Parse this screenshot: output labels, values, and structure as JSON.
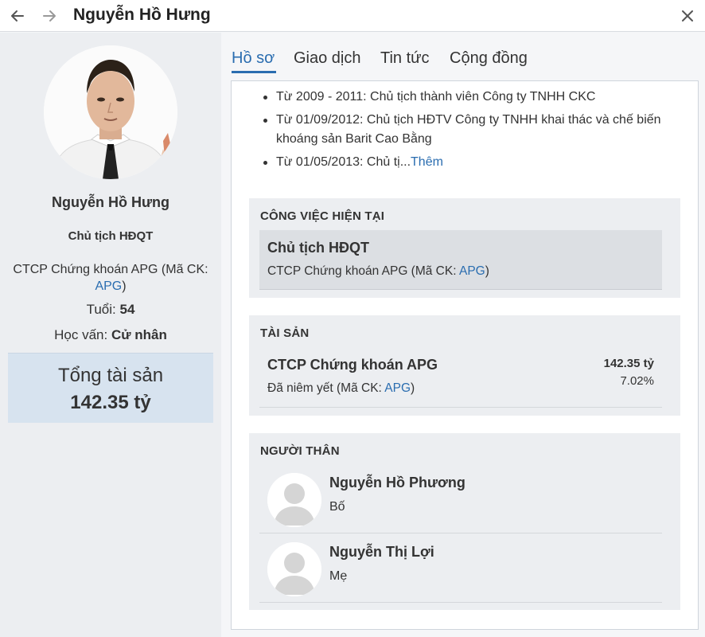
{
  "window": {
    "title": "Nguyễn Hồ Hưng",
    "back_icon": "arrow-left-icon",
    "forward_icon": "arrow-right-icon",
    "close_icon": "close-icon"
  },
  "profile": {
    "name": "Nguyễn Hồ Hưng",
    "role": "Chủ tịch HĐQT",
    "company_prefix": "CTCP Chứng khoán APG (Mã CK: ",
    "company_ticker": "APG",
    "company_suffix": ")",
    "age_label": "Tuổi: ",
    "age_value": "54",
    "education_label": "Học vấn: ",
    "education_value": "Cử nhân",
    "total_assets_label": "Tổng tài sản",
    "total_assets_value": "142.35 tỷ"
  },
  "tabs": [
    {
      "label": "Hồ sơ",
      "active": true
    },
    {
      "label": "Giao dịch",
      "active": false
    },
    {
      "label": "Tin tức",
      "active": false
    },
    {
      "label": "Cộng đồng",
      "active": false
    }
  ],
  "bio": {
    "items": [
      "Từ 2009 - 2011: Chủ tịch thành viên Công ty TNHH CKC",
      "Từ 01/09/2012: Chủ tịch HĐTV Công ty TNHH khai thác và chế biến khoáng sản Barit Cao Bằng",
      "Từ 01/05/2013: Chủ tị..."
    ],
    "more_link": "Thêm"
  },
  "current_job": {
    "section_title": "CÔNG VIỆC HIỆN TẠI",
    "title": "Chủ tịch HĐQT",
    "company_prefix": "CTCP Chứng khoán APG (Mã CK: ",
    "ticker": "APG",
    "company_suffix": ")"
  },
  "assets": {
    "section_title": "TÀI SẢN",
    "items": [
      {
        "name": "CTCP Chứng khoán APG",
        "status_prefix": "Đã niêm yết (Mã CK: ",
        "ticker": "APG",
        "status_suffix": ")",
        "value": "142.35 tỷ",
        "percent": "7.02%"
      }
    ]
  },
  "relatives": {
    "section_title": "NGƯỜI THÂN",
    "items": [
      {
        "name": "Nguyễn Hồ Phương",
        "relation": "Bố"
      },
      {
        "name": "Nguyễn Thị Lợi",
        "relation": "Mẹ"
      }
    ]
  },
  "colors": {
    "accent": "#2a6db0",
    "asset_box_bg": "#d7e3ef",
    "card_bg": "#eceef1"
  }
}
